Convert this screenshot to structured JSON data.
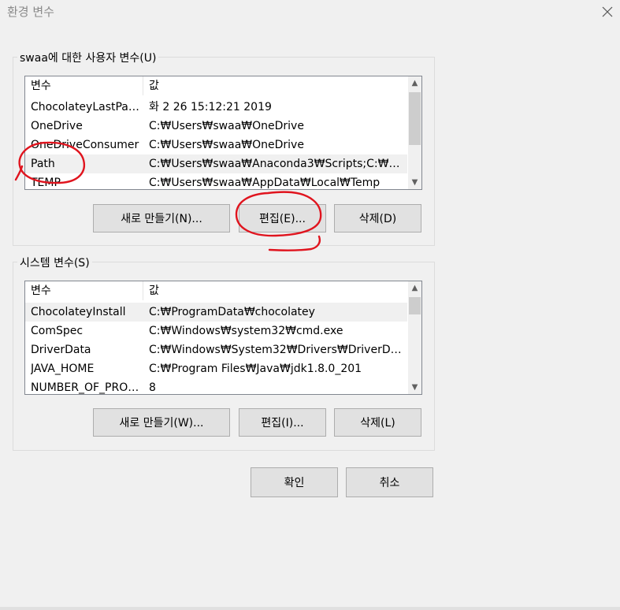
{
  "window": {
    "title": "환경 변수",
    "close_icon": "close-icon"
  },
  "user_vars": {
    "group_label": "swaa에 대한 사용자 변수(U)",
    "columns": [
      "변수",
      "값"
    ],
    "rows": [
      {
        "name": "ChocolateyLastPath...",
        "value": "화 2 26 15:12:21 2019"
      },
      {
        "name": "OneDrive",
        "value": "C:₩Users₩swaa₩OneDrive"
      },
      {
        "name": "OneDriveConsumer",
        "value": "C:₩Users₩swaa₩OneDrive"
      },
      {
        "name": "Path",
        "value": "C:₩Users₩swaa₩Anaconda3₩Scripts;C:₩User..."
      },
      {
        "name": "TEMP",
        "value": "C:₩Users₩swaa₩AppData₩Local₩Temp"
      }
    ],
    "selected_index": 3,
    "buttons": {
      "new": "새로 만들기(N)...",
      "edit": "편집(E)...",
      "delete": "삭제(D)"
    }
  },
  "system_vars": {
    "group_label": "시스템 변수(S)",
    "columns": [
      "변수",
      "값"
    ],
    "rows": [
      {
        "name": "ChocolateyInstall",
        "value": "C:₩ProgramData₩chocolatey"
      },
      {
        "name": "ComSpec",
        "value": "C:₩Windows₩system32₩cmd.exe"
      },
      {
        "name": "DriverData",
        "value": "C:₩Windows₩System32₩Drivers₩DriverData"
      },
      {
        "name": "JAVA_HOME",
        "value": "C:₩Program Files₩Java₩jdk1.8.0_201"
      },
      {
        "name": "NUMBER_OF_PROC...",
        "value": "8"
      }
    ],
    "selected_index": 0,
    "buttons": {
      "new": "새로 만들기(W)...",
      "edit": "편집(I)...",
      "delete": "삭제(L)"
    }
  },
  "dialog_buttons": {
    "ok": "확인",
    "cancel": "취소"
  },
  "colors": {
    "annotation": "#e0141e",
    "selection": "#f0f0f0",
    "list_border": "#828790"
  }
}
